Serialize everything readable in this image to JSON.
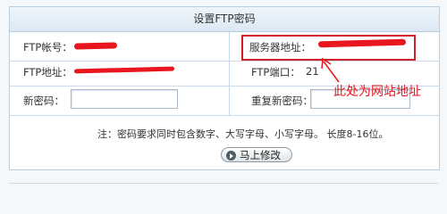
{
  "form": {
    "title": "设置FTP密码",
    "ftp_account_label": "FTP帐号：",
    "server_address_label": "服务器地址：",
    "ftp_address_label": "FTP地址：",
    "ftp_port_label": "FTP端口：",
    "ftp_port_value": "21",
    "new_password_label": "新密码：",
    "confirm_password_label": "重复新密码：",
    "new_password_value": "",
    "confirm_password_value": "",
    "note": "注：密码要求同时包含数字、大写字母、小写字母。 长度8-16位。",
    "submit_label": "马上修改"
  },
  "annotation": {
    "text": "此处为网站地址",
    "color": "#e8161e"
  },
  "colors": {
    "redaction": "#e8161e",
    "border": "#b9cfe0"
  }
}
